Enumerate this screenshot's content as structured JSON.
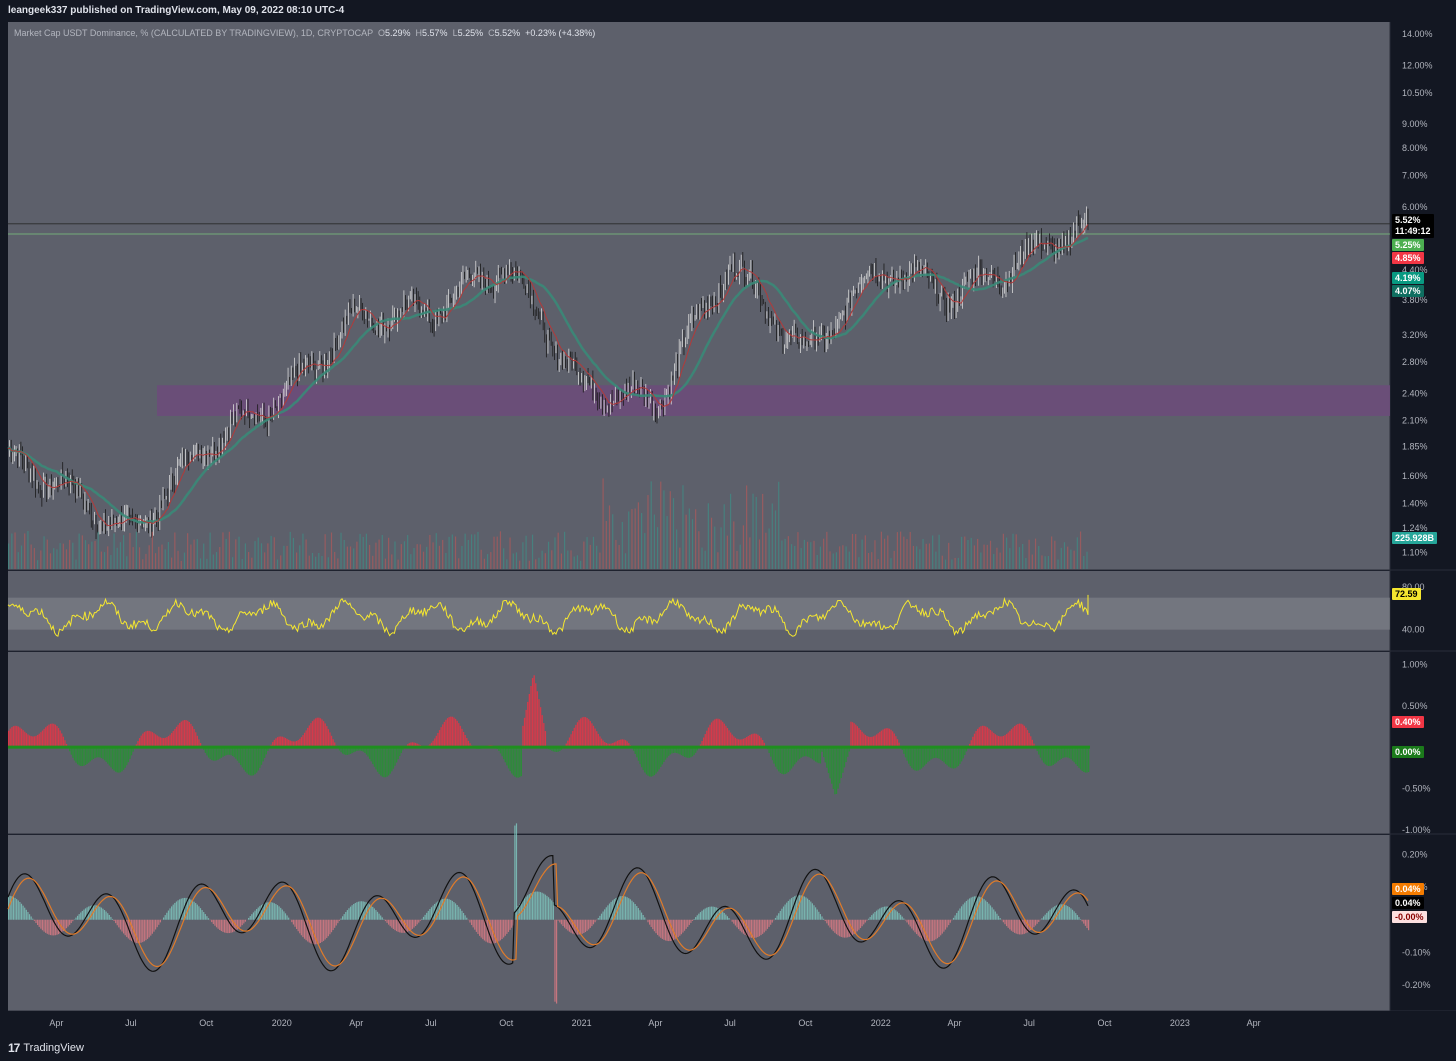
{
  "header": {
    "publisher": "leangeek337 published on TradingView.com, May 09, 2022 08:10 UTC-4"
  },
  "legend": {
    "symbol": "Market Cap USDT Dominance, % (CALCULATED BY TRADINGVIEW), 1D, CRYPTOCAP",
    "o_label": "O",
    "o": "5.29%",
    "h_label": "H",
    "h": "5.57%",
    "l_label": "L",
    "l": "5.25%",
    "c_label": "C",
    "c": "5.52%",
    "change": "+0.23% (+4.38%)"
  },
  "price_tags": {
    "last": "5.52%",
    "countdown": "11:49:12",
    "green": "5.25%",
    "red": "4.85%",
    "teal1": "4.19%",
    "teal2": "4.07%",
    "volume": "225.928B",
    "rsi": "72.59",
    "hist1": "0.40%",
    "hist1_zero": "0.00%",
    "osc_orange": "0.04%",
    "osc_black": "0.04%",
    "osc_neg": "-0.00%"
  },
  "price_axis": [
    "14.00%",
    "12.00%",
    "10.50%",
    "9.00%",
    "8.00%",
    "7.00%",
    "6.00%",
    "4.40%",
    "3.80%",
    "3.20%",
    "2.80%",
    "2.40%",
    "2.10%",
    "1.85%",
    "1.60%",
    "1.40%",
    "1.24%",
    "1.10%"
  ],
  "rsi_axis": [
    "80.00",
    "40.00"
  ],
  "hist_axis": [
    "1.00%",
    "0.50%",
    "-0.50%",
    "-1.00%"
  ],
  "osc_axis": [
    "0.20%",
    "0.10%",
    "-0.10%",
    "-0.20%"
  ],
  "time_axis": [
    "Apr",
    "Jul",
    "Oct",
    "2020",
    "Apr",
    "Jul",
    "Oct",
    "2021",
    "Apr",
    "Jul",
    "Oct",
    "2022",
    "Apr",
    "Jul",
    "Oct",
    "2023",
    "Apr"
  ],
  "footer": {
    "brand": "TradingView"
  },
  "colors": {
    "pane": "#5d606b",
    "zone": "#6b4d7a",
    "rsi": "#f5e72f",
    "bull": "#2e8b3a",
    "bear": "#d53a4a",
    "ema": "#b23a3a",
    "sma": "#3a8a78"
  },
  "chart_data": [
    {
      "type": "candlestick",
      "title": "Market Cap USDT Dominance, % (CALCULATED BY TRADINGVIEW), 1D, CRYPTOCAP",
      "scale": "log",
      "ylim": [
        1.05,
        14.5
      ],
      "x": [
        "2019-02",
        "2019-04",
        "2019-07",
        "2019-10",
        "2020-01",
        "2020-04",
        "2020-07",
        "2020-10",
        "2021-01",
        "2021-04",
        "2021-07",
        "2021-10",
        "2022-01",
        "2022-04",
        "2022-05"
      ],
      "close": [
        1.75,
        1.55,
        1.2,
        1.9,
        2.35,
        3.5,
        3.6,
        4.55,
        2.5,
        2.3,
        4.6,
        2.9,
        4.5,
        3.9,
        5.52
      ],
      "overlays": [
        "moving average red",
        "moving average teal"
      ],
      "zone": [
        2.15,
        2.5
      ],
      "horizontal_lines": [
        5.52,
        5.25
      ]
    },
    {
      "type": "line",
      "name": "RSI",
      "ylim": [
        20,
        95
      ],
      "band": [
        40,
        70
      ],
      "last": 72.59
    },
    {
      "type": "bar",
      "name": "histogram",
      "ylim": [
        -1.05,
        1.15
      ],
      "last": 0.4
    },
    {
      "type": "line",
      "name": "oscillator",
      "ylim": [
        -0.28,
        0.26
      ],
      "last": 0.04
    }
  ]
}
